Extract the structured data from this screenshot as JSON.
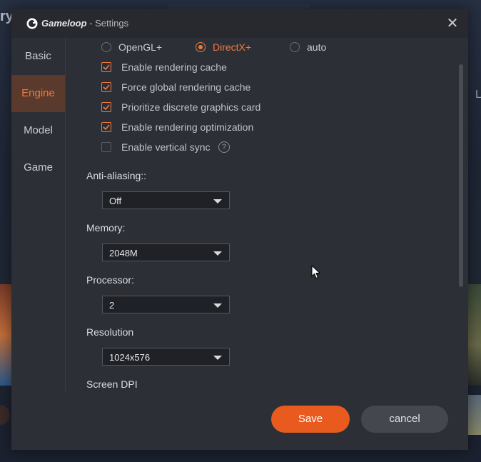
{
  "background": {
    "partial_left_text": "ry",
    "partial_right_text": "L"
  },
  "window": {
    "app_name": "Gameloop",
    "title_suffix": " - Settings",
    "close_icon": "close-icon"
  },
  "sidebar": {
    "items": [
      {
        "label": "Basic",
        "active": false
      },
      {
        "label": "Engine",
        "active": true
      },
      {
        "label": "Model",
        "active": false
      },
      {
        "label": "Game",
        "active": false
      }
    ]
  },
  "engine": {
    "render_modes": [
      {
        "label": "OpenGL+",
        "selected": false
      },
      {
        "label": "DirectX+",
        "selected": true
      },
      {
        "label": "auto",
        "selected": false
      }
    ],
    "checkboxes": [
      {
        "label": "Enable rendering cache",
        "checked": true
      },
      {
        "label": "Force global rendering cache",
        "checked": true
      },
      {
        "label": "Prioritize discrete graphics card",
        "checked": true
      },
      {
        "label": "Enable rendering optimization",
        "checked": true
      },
      {
        "label": "Enable vertical sync",
        "checked": false
      }
    ],
    "help_glyph": "?",
    "anti_aliasing": {
      "label": "Anti-aliasing::",
      "value": "Off"
    },
    "memory": {
      "label": "Memory:",
      "value": "2048M"
    },
    "processor": {
      "label": "Processor:",
      "value": "2"
    },
    "resolution": {
      "label": "Resolution",
      "value": "1024x576"
    },
    "screen_dpi": {
      "label": "Screen DPI"
    }
  },
  "footer": {
    "save_label": "Save",
    "cancel_label": "cancel"
  },
  "colors": {
    "accent": "#f07a3c",
    "save_button": "#e85a1e",
    "dialog_bg": "#2d2f36"
  }
}
